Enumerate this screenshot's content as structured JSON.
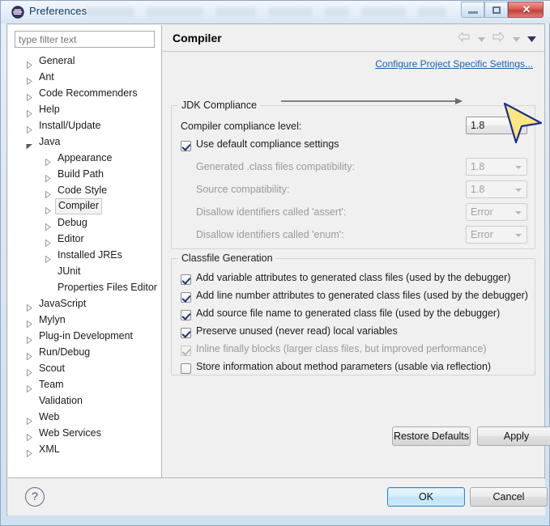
{
  "window": {
    "title": "Preferences",
    "icon": "eclipse-icon",
    "controls": {
      "minimize": "minimize-button",
      "maximize": "maximize-button",
      "close_glyph": "✕"
    }
  },
  "sidebar": {
    "filter": {
      "placeholder": "type filter text",
      "value": ""
    },
    "items": [
      {
        "label": "General",
        "depth": 0,
        "expandable": true,
        "expanded": false,
        "selected": false
      },
      {
        "label": "Ant",
        "depth": 0,
        "expandable": true,
        "expanded": false,
        "selected": false
      },
      {
        "label": "Code Recommenders",
        "depth": 0,
        "expandable": true,
        "expanded": false,
        "selected": false
      },
      {
        "label": "Help",
        "depth": 0,
        "expandable": true,
        "expanded": false,
        "selected": false
      },
      {
        "label": "Install/Update",
        "depth": 0,
        "expandable": true,
        "expanded": false,
        "selected": false
      },
      {
        "label": "Java",
        "depth": 0,
        "expandable": true,
        "expanded": true,
        "selected": false
      },
      {
        "label": "Appearance",
        "depth": 1,
        "expandable": true,
        "expanded": false,
        "selected": false
      },
      {
        "label": "Build Path",
        "depth": 1,
        "expandable": true,
        "expanded": false,
        "selected": false
      },
      {
        "label": "Code Style",
        "depth": 1,
        "expandable": true,
        "expanded": false,
        "selected": false
      },
      {
        "label": "Compiler",
        "depth": 1,
        "expandable": true,
        "expanded": false,
        "selected": true
      },
      {
        "label": "Debug",
        "depth": 1,
        "expandable": true,
        "expanded": false,
        "selected": false
      },
      {
        "label": "Editor",
        "depth": 1,
        "expandable": true,
        "expanded": false,
        "selected": false
      },
      {
        "label": "Installed JREs",
        "depth": 1,
        "expandable": true,
        "expanded": false,
        "selected": false
      },
      {
        "label": "JUnit",
        "depth": 1,
        "expandable": false,
        "expanded": false,
        "selected": false
      },
      {
        "label": "Properties Files Editor",
        "depth": 1,
        "expandable": false,
        "expanded": false,
        "selected": false
      },
      {
        "label": "JavaScript",
        "depth": 0,
        "expandable": true,
        "expanded": false,
        "selected": false
      },
      {
        "label": "Mylyn",
        "depth": 0,
        "expandable": true,
        "expanded": false,
        "selected": false
      },
      {
        "label": "Plug-in Development",
        "depth": 0,
        "expandable": true,
        "expanded": false,
        "selected": false
      },
      {
        "label": "Run/Debug",
        "depth": 0,
        "expandable": true,
        "expanded": false,
        "selected": false
      },
      {
        "label": "Scout",
        "depth": 0,
        "expandable": true,
        "expanded": false,
        "selected": false
      },
      {
        "label": "Team",
        "depth": 0,
        "expandable": true,
        "expanded": false,
        "selected": false
      },
      {
        "label": "Validation",
        "depth": 0,
        "expandable": false,
        "expanded": false,
        "selected": false
      },
      {
        "label": "Web",
        "depth": 0,
        "expandable": true,
        "expanded": false,
        "selected": false
      },
      {
        "label": "Web Services",
        "depth": 0,
        "expandable": true,
        "expanded": false,
        "selected": false
      },
      {
        "label": "XML",
        "depth": 0,
        "expandable": true,
        "expanded": false,
        "selected": false
      }
    ]
  },
  "page": {
    "title": "Compiler",
    "configure_link": "Configure Project Specific Settings...",
    "nav": {
      "back": "back-arrow-icon",
      "forward": "forward-arrow-icon",
      "menu": "view-menu-icon"
    },
    "jdk_group": {
      "title": "JDK Compliance",
      "compliance_label": "Compiler compliance level:",
      "compliance_value": "1.8",
      "use_default_label": "Use default compliance settings",
      "use_default_checked": true,
      "rows": [
        {
          "label": "Generated .class files compatibility:",
          "value": "1.8",
          "disabled": true
        },
        {
          "label": "Source compatibility:",
          "value": "1.8",
          "disabled": true
        },
        {
          "label": "Disallow identifiers called 'assert':",
          "value": "Error",
          "disabled": true
        },
        {
          "label": "Disallow identifiers called 'enum':",
          "value": "Error",
          "disabled": true
        }
      ]
    },
    "classfile_group": {
      "title": "Classfile Generation",
      "options": [
        {
          "label": "Add variable attributes to generated class files (used by the debugger)",
          "checked": true,
          "disabled": false
        },
        {
          "label": "Add line number attributes to generated class files (used by the debugger)",
          "checked": true,
          "disabled": false
        },
        {
          "label": "Add source file name to generated class file (used by the debugger)",
          "checked": true,
          "disabled": false
        },
        {
          "label": "Preserve unused (never read) local variables",
          "checked": true,
          "disabled": false
        },
        {
          "label": "Inline finally blocks (larger class files, but improved performance)",
          "checked": true,
          "disabled": true
        },
        {
          "label": "Store information about method parameters (usable via reflection)",
          "checked": false,
          "disabled": false
        }
      ]
    },
    "restore_defaults_label": "Restore Defaults",
    "apply_label": "Apply"
  },
  "footer": {
    "help": "?",
    "ok_label": "OK",
    "cancel_label": "Cancel"
  },
  "annotation": {
    "arrow_target": "compliance-level-combo",
    "line_color": "#3f3f3f",
    "cursor_fill": "#ffe680",
    "cursor_stroke": "#1c2f8a"
  },
  "colors": {
    "link": "#1c5fb0",
    "close_button": "#c2403c",
    "default_button_border": "#2f87c9"
  }
}
